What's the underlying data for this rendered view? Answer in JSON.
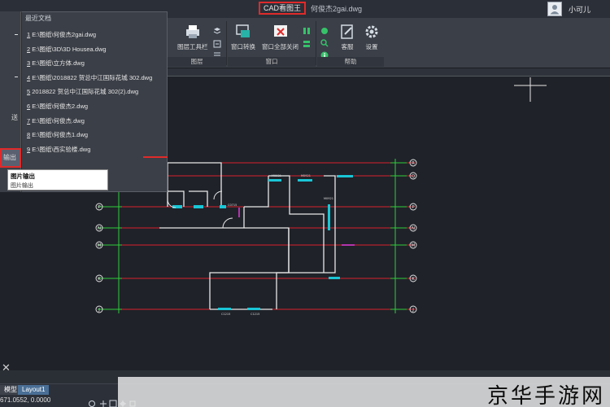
{
  "window": {
    "app_name": "CAD看图王",
    "file_name": "何俊杰2gai.dwg",
    "user_name": "小可儿"
  },
  "ribbon": {
    "buttons": {
      "layer_toolbar": "图层工具栏",
      "window_switch": "窗口转换",
      "close_all_windows": "窗口全部关闭",
      "customer_service": "客服",
      "settings": "设置"
    },
    "groups": {
      "layer": "图层",
      "window": "窗口",
      "help": "帮助"
    }
  },
  "app_menu": {
    "items": [
      "送",
      "输出"
    ]
  },
  "recent_docs": {
    "title": "最近文档",
    "items": [
      {
        "num": "1",
        "path": "E:\\图纸\\何俊杰2gai.dwg"
      },
      {
        "num": "2",
        "path": "E:\\图纸\\3D\\3D Housea.dwg"
      },
      {
        "num": "3",
        "path": "E:\\图纸\\立方体.dwg"
      },
      {
        "num": "4",
        "path": "E:\\图纸\\2018822 贺总中江国际花城 302.dwg"
      },
      {
        "num": "5",
        "path": "2018822 贺总中江国际花城 302(2).dwg"
      },
      {
        "num": "6",
        "path": "E:\\图纸\\何俊杰2.dwg"
      },
      {
        "num": "7",
        "path": "E:\\图纸\\何俊杰.dwg"
      },
      {
        "num": "8",
        "path": "E:\\图纸\\何俊杰1.dwg"
      },
      {
        "num": "9",
        "path": "E:\\图纸\\西实验楼.dwg"
      }
    ]
  },
  "tooltip": {
    "title": "图片输出",
    "desc": "图片输出"
  },
  "axes": {
    "right": [
      "R",
      "Q",
      "P",
      "N",
      "M",
      "K",
      "J"
    ],
    "left": [
      "P",
      "N",
      "M",
      "K",
      "J"
    ]
  },
  "tabs": {
    "model": "模型",
    "layout1": "Layout1"
  },
  "status": {
    "coords": "671.0552, 0.0000"
  },
  "watermark": {
    "text": "京华手游网"
  },
  "colors": {
    "highlight_red": "#e02a2a",
    "grid_red": "#d8202a",
    "axis_green": "#2fcf3a",
    "wall_white": "#e8e8e8",
    "cyan": "#19c6d6",
    "magenta": "#e33ad8"
  }
}
